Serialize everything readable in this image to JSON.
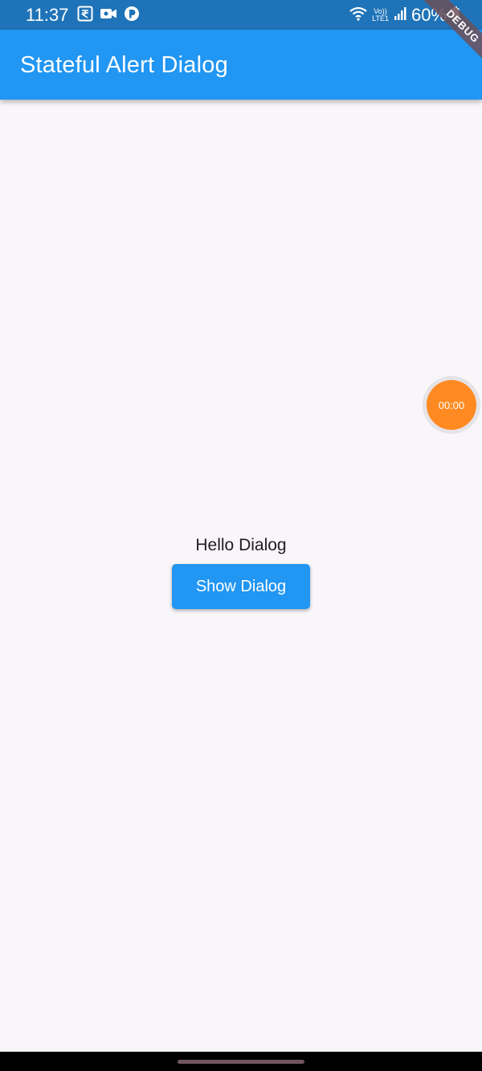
{
  "status_bar": {
    "time": "11:37",
    "battery": "60%",
    "network_label_top": "Vo))",
    "network_label_bottom": "LTE1",
    "left_icons": [
      "rupee-icon",
      "video-camera-icon",
      "app-notification-icon"
    ],
    "right_icons": [
      "wifi-icon",
      "volte-icon",
      "signal-icon",
      "battery-icon"
    ]
  },
  "app_bar": {
    "title": "Stateful Alert Dialog",
    "color": "#2196f3"
  },
  "debug_banner": "DEBUG",
  "main": {
    "hello_text": "Hello Dialog",
    "show_button_label": "Show Dialog"
  },
  "timer_bubble": {
    "time": "00:00",
    "color": "#ff8a22"
  },
  "colors": {
    "status_bar": "#1f73b8",
    "background": "#f8f6f9",
    "accent": "#2196f3"
  }
}
